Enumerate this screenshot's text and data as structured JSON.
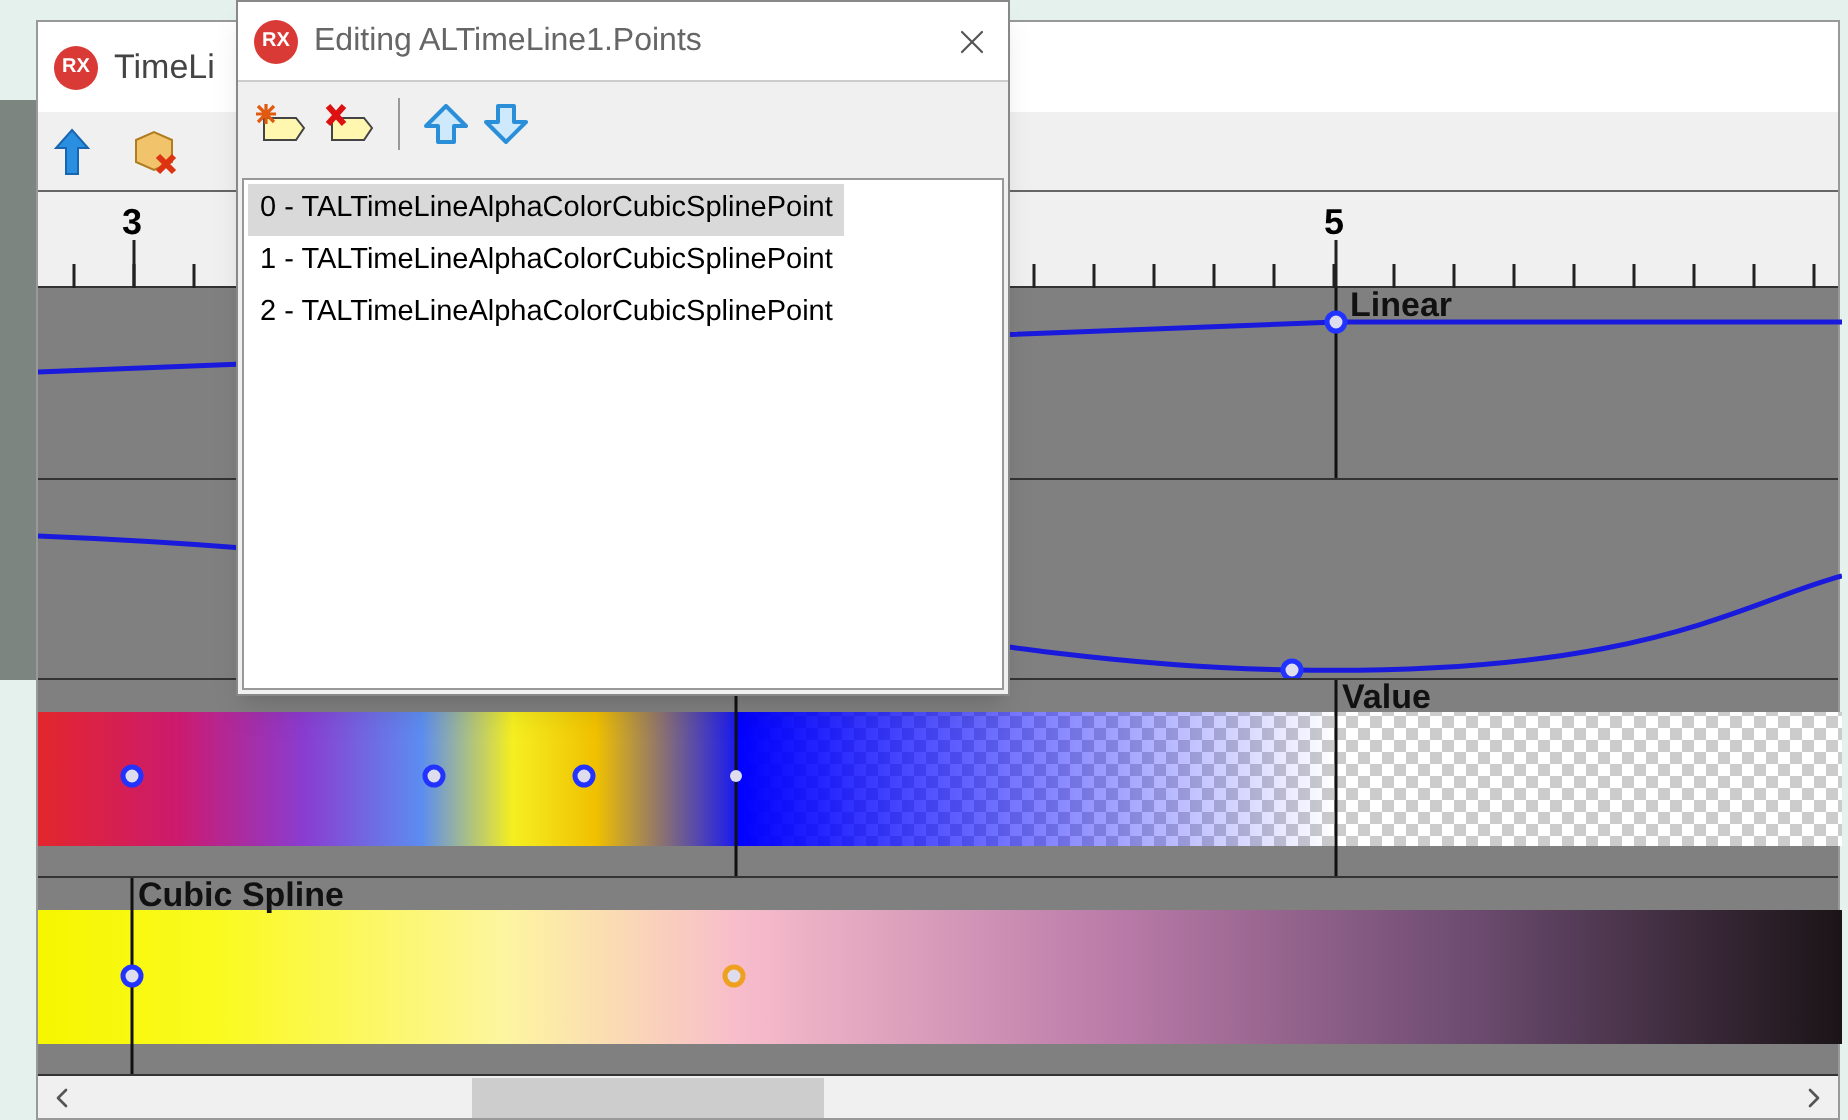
{
  "main_window": {
    "logo": "RX",
    "title": "TimeLi"
  },
  "ruler": {
    "labels": [
      "3",
      "5"
    ]
  },
  "tracks": [
    {
      "kind": "line",
      "label": "Linear"
    },
    {
      "kind": "curve"
    },
    {
      "kind": "rainbow",
      "label": "Value"
    },
    {
      "kind": "fade",
      "label": "Cubic Spline"
    }
  ],
  "dialog": {
    "logo": "RX",
    "title": "Editing ALTimeLine1.Points",
    "items": [
      {
        "text": "0 - TALTimeLineAlphaColorCubicSplinePoint",
        "selected": true
      },
      {
        "text": "1 - TALTimeLineAlphaColorCubicSplinePoint",
        "selected": false
      },
      {
        "text": "2 - TALTimeLineAlphaColorCubicSplinePoint",
        "selected": false
      }
    ]
  }
}
